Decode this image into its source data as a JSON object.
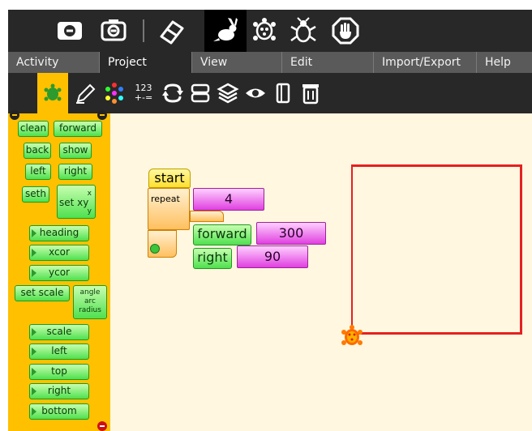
{
  "toolbar": {
    "icons": [
      "stop-icon",
      "camera-icon",
      "eraser-icon",
      "run-rabbit-icon",
      "turtle-walk-icon",
      "bug-debug-icon",
      "stop-hand-icon"
    ]
  },
  "tabs": [
    {
      "label": "Activity"
    },
    {
      "label": "Project"
    },
    {
      "label": "View"
    },
    {
      "label": "Edit"
    },
    {
      "label": "Import/Export"
    },
    {
      "label": "Help"
    }
  ],
  "palette_toolbar": {
    "icons": [
      "turtle-palette-icon",
      "pen-palette-icon",
      "colors-palette-icon",
      "numbers-palette-icon",
      "flow-palette-icon",
      "blocks-palette-icon",
      "extras-palette-icon",
      "sensors-palette-icon",
      "media-palette-icon",
      "trash-icon"
    ],
    "numbers_top": "123",
    "numbers_bottom": "+-="
  },
  "palette": {
    "clean": "clean",
    "forward": "forward",
    "back": "back",
    "show": "show",
    "left": "left",
    "right": "right",
    "seth": "seth",
    "setxy": "set xy",
    "setxy_x": "x",
    "setxy_y": "y",
    "heading": "heading",
    "xcor": "xcor",
    "ycor": "ycor",
    "setscale": "set scale",
    "arc_angle": "angle",
    "arc_label": "arc",
    "arc_radius": "radius",
    "scale": "scale",
    "left_sensor": "left",
    "top_sensor": "top",
    "right_sensor": "right",
    "bottom_sensor": "bottom"
  },
  "program": {
    "start": "start",
    "repeat": "repeat",
    "repeat_count": "4",
    "forward": "forward",
    "forward_value": "300",
    "right": "right",
    "right_value": "90"
  },
  "colors": {
    "palette_bg": "#ffc000",
    "canvas_bg": "#fff7df",
    "drawing": "#e62020",
    "toolbar": "#282828"
  }
}
